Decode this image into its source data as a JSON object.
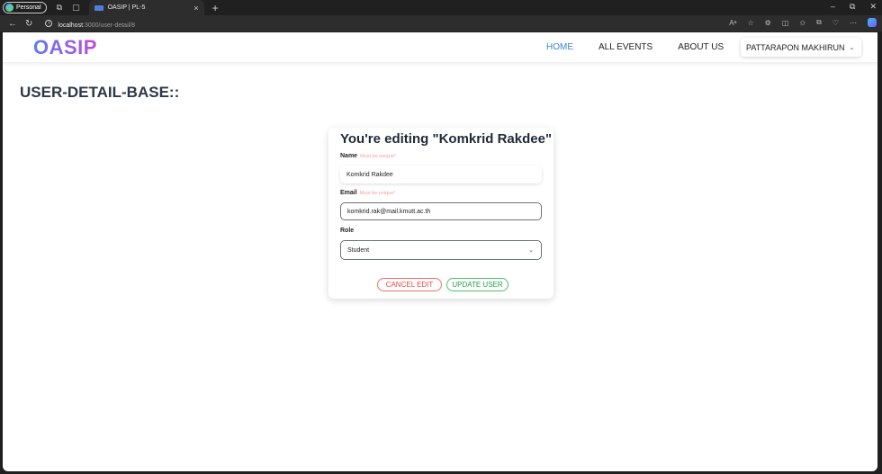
{
  "browser": {
    "profile_label": "Personal",
    "tab_title": "OASIP | PL-5",
    "tab_close": "×",
    "new_tab": "+",
    "url_host": "localhost",
    "url_path": ":3000/user-detail/8",
    "window_controls": [
      "–",
      "⧉",
      "✕"
    ]
  },
  "navbar": {
    "logo": "OASIP",
    "links": [
      "HOME",
      "ALL EVENTS",
      "ABOUT US"
    ],
    "active_link": "HOME",
    "user_name": "PATTARAPON MAKHIRUN"
  },
  "page": {
    "heading": "USER-DETAIL-BASE::"
  },
  "form": {
    "title": "You're editing \"Komkrid Rakdee\"",
    "name_label": "Name",
    "name_hint": "Must be unique*",
    "name_value": "Komkrid Rakdee",
    "email_label": "Email",
    "email_hint": "Must be unique*",
    "email_value": "komkrid.rak@mail.kmutt.ac.th",
    "role_label": "Role",
    "role_value": "Student",
    "cancel_label": "CANCEL EDIT",
    "update_label": "UPDATE USER"
  },
  "colors": {
    "accent": "#3a86d8",
    "cancel": "#ef4444",
    "update": "#22a447",
    "hint": "#f4a0a0"
  }
}
